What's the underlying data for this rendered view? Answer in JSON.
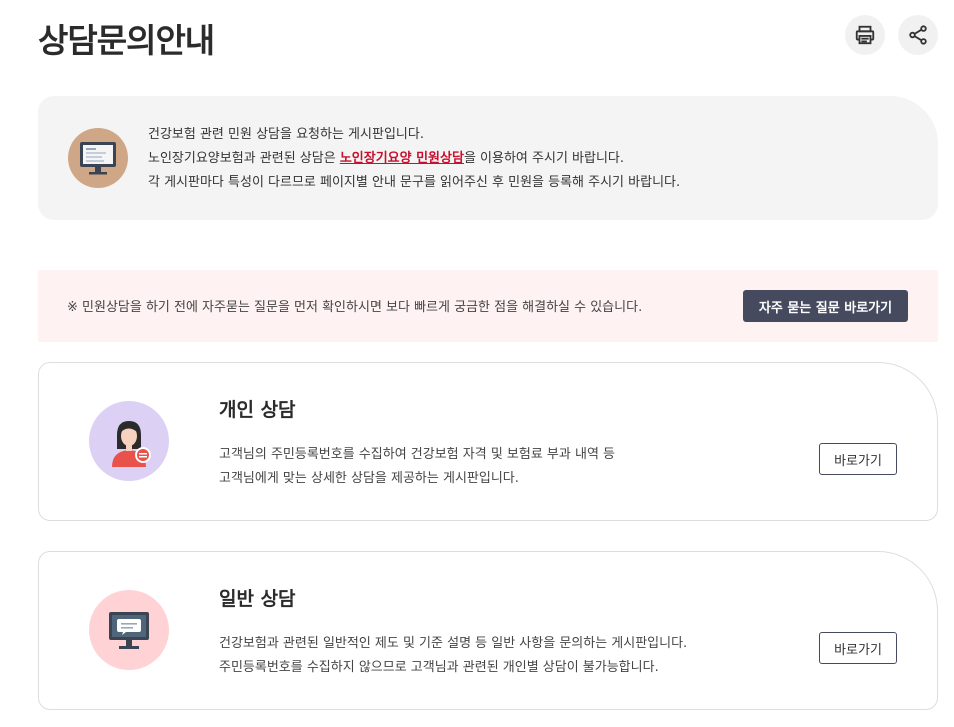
{
  "page": {
    "title": "상담문의안내"
  },
  "toolbar": {
    "print_icon": "print-icon",
    "share_icon": "share-icon"
  },
  "intro": {
    "icon": "monitor-icon",
    "line1": "건강보험 관련 민원 상담을 요청하는 게시판입니다.",
    "line2_prefix": "노인장기요양보험과 관련된 상담은 ",
    "line2_link": "노인장기요양 민원상담",
    "line2_suffix": "을 이용하여 주시기 바랍니다.",
    "line3": "각 게시판마다 특성이 다르므로 페이지별 안내 문구를 읽어주신 후 민원을 등록해 주시기 바랍니다."
  },
  "faq": {
    "notice": "※ 민원상담을 하기 전에 자주묻는 질문을 먼저 확인하시면 보다 빠르게 궁금한 점을 해결하실 수 있습니다.",
    "button_label": "자주 묻는 질문 바로가기"
  },
  "cards": [
    {
      "icon": "counselor-icon",
      "title": "개인 상담",
      "desc_line1": "고객님의 주민등록번호를 수집하여 건강보험 자격 및 보험료 부과 내역 등",
      "desc_line2": "고객님에게 맞는 상세한 상담을 제공하는 게시판입니다.",
      "button_label": "바로가기"
    },
    {
      "icon": "monitor-chat-icon",
      "title": "일반 상담",
      "desc_line1": "건강보험과 관련된 일반적인 제도 및 기준 설명 등 일반 사항을 문의하는 게시판입니다.",
      "desc_line2": "주민등록번호를 수집하지 않으므로 고객님과 관련된 개인별 상담이 불가능합니다.",
      "button_label": "바로가기"
    }
  ],
  "colors": {
    "accent_dark": "#464a5e",
    "link_red": "#c8102e",
    "faq_bg": "#fff2f2",
    "intro_bg": "#f4f4f4"
  }
}
